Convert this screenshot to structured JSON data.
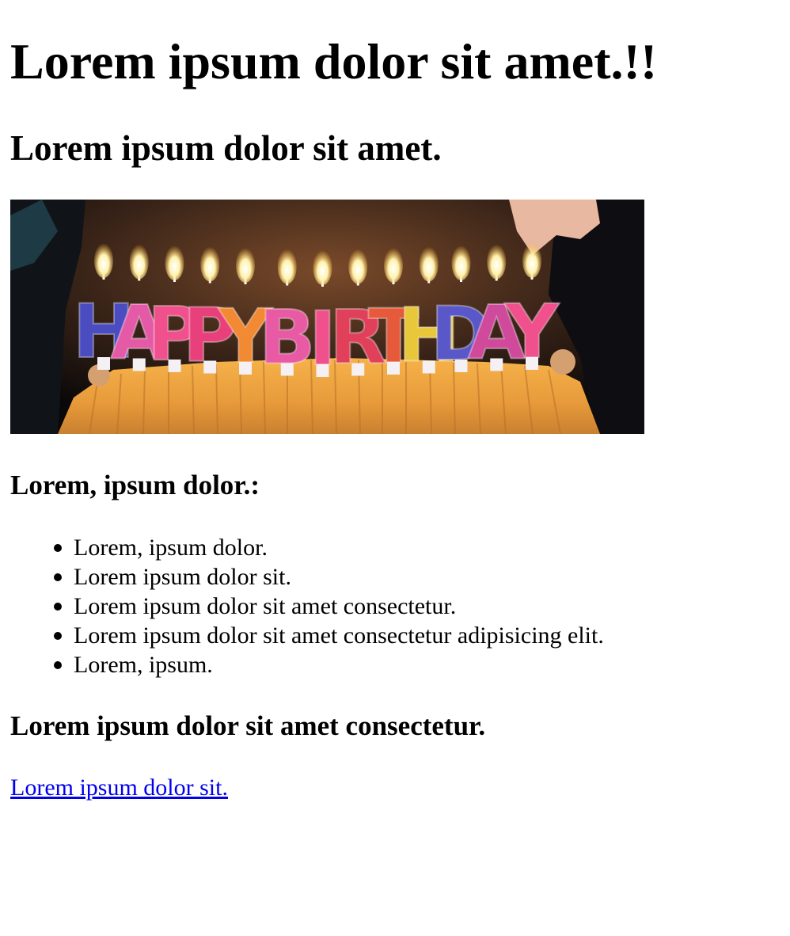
{
  "page": {
    "title": "Lorem ipsum dolor sit amet.!!",
    "subtitle": "Lorem ipsum dolor sit amet."
  },
  "hero_image": {
    "letters": [
      "H",
      "A",
      "P",
      "P",
      "Y",
      "B",
      "I",
      "R",
      "T",
      "H",
      "D",
      "A",
      "Y"
    ],
    "letter_colors": [
      "#4a4cc0",
      "#e55aa6",
      "#f0508c",
      "#e8407a",
      "#f28a34",
      "#e95aa4",
      "#f0508c",
      "#e0405a",
      "#e45a3a",
      "#e8c83a",
      "#5a58c8",
      "#d04a9c",
      "#f0508c"
    ]
  },
  "section": {
    "heading": "Lorem, ipsum dolor.:",
    "items": [
      "Lorem, ipsum dolor.",
      "Lorem ipsum dolor sit.",
      "Lorem ipsum dolor sit amet consectetur.",
      "Lorem ipsum dolor sit amet consectetur adipisicing elit.",
      "Lorem, ipsum."
    ]
  },
  "closing": {
    "heading": "Lorem ipsum dolor sit amet consectetur.",
    "link_text": "Lorem ipsum dolor sit."
  },
  "colors": {
    "link": "#0000ee",
    "text": "#000000",
    "background": "#ffffff"
  }
}
